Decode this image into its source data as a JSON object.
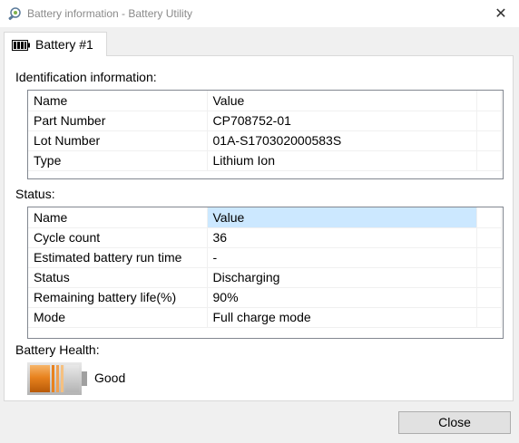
{
  "window": {
    "title": "Battery information - Battery Utility",
    "app_icon": "battery-utility-icon",
    "close_glyph": "✕"
  },
  "tab": {
    "label": "Battery #1",
    "icon": "battery-icon"
  },
  "identification": {
    "label": "Identification information:",
    "header": {
      "name": "Name",
      "value": "Value"
    },
    "rows": [
      {
        "name": "Part Number",
        "value": "CP708752-01"
      },
      {
        "name": "Lot Number",
        "value": "01A-S170302000583S"
      },
      {
        "name": "Type",
        "value": "Lithium Ion"
      }
    ]
  },
  "status": {
    "label": "Status:",
    "header": {
      "name": "Name",
      "value": "Value"
    },
    "rows": [
      {
        "name": "Cycle count",
        "value": "36"
      },
      {
        "name": "Estimated battery run time",
        "value": "-"
      },
      {
        "name": "Status",
        "value": "Discharging"
      },
      {
        "name": "Remaining battery life(%)",
        "value": "90%"
      },
      {
        "name": "Mode",
        "value": "Full charge mode"
      }
    ]
  },
  "health": {
    "label": "Battery Health:",
    "value": "Good",
    "icon": "battery-health-icon",
    "colors": {
      "charge": "#e8821e",
      "empty": "#c8c8c8"
    }
  },
  "buttons": {
    "close": "Close"
  },
  "colors": {
    "selection": "#cce8ff",
    "button": "#e1e1e1"
  }
}
